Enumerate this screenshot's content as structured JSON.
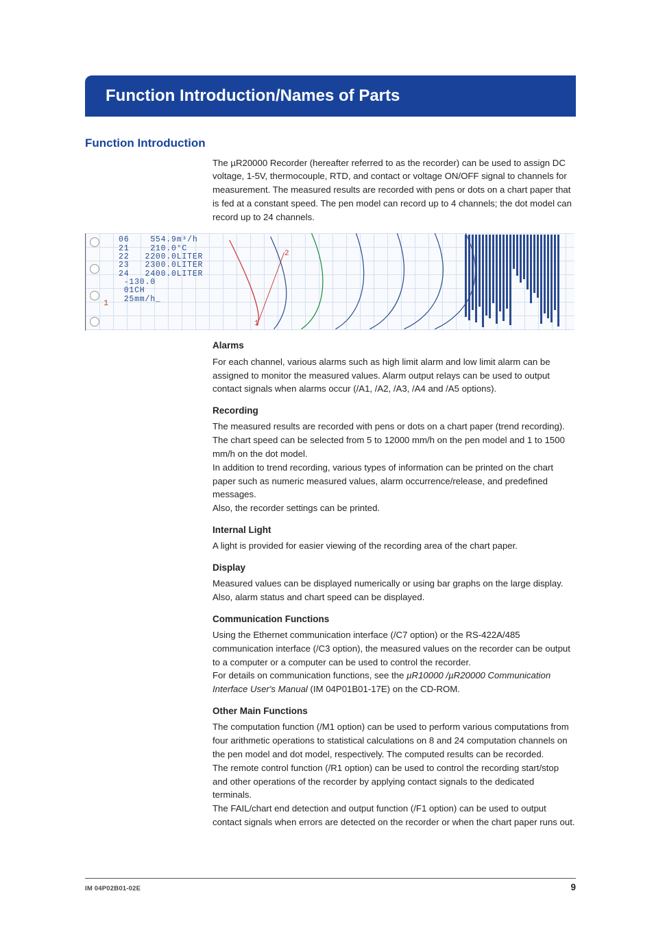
{
  "banner_title": "Function Introduction/Names of Parts",
  "section_title": "Function Introduction",
  "intro_paragraph": "The µR20000 Recorder (hereafter referred to as the recorder) can be used to assign DC voltage, 1-5V, thermocouple, RTD, and contact or voltage ON/OFF signal to channels for measurement. The measured results are recorded with pens or dots on a chart paper that is fed at a constant speed. The pen model can record up to 4 channels; the dot model can record up to 24 channels.",
  "figure": {
    "lcd_lines": "06    554.9m³/h\n21    210.0°C\n22   2200.0LITER\n23   2300.0LITER\n24   2400.0LITER\n -130.0\n 01CH\n 25mm/h_",
    "left_index": "1",
    "callouts": {
      "c1": "1",
      "c2": "2"
    }
  },
  "sections": [
    {
      "heading": "Alarms",
      "paragraphs": [
        "For each channel, various alarms such as high limit alarm and low limit alarm can be assigned to monitor the measured values. Alarm output relays can be used to output contact signals when alarms occur (/A1, /A2, /A3, /A4 and /A5 options)."
      ]
    },
    {
      "heading": "Recording",
      "paragraphs": [
        "The measured results are recorded with pens or dots on a chart paper (trend recording). The chart speed can be selected from 5 to 12000 mm/h on the pen model and 1 to 1500 mm/h on the dot model.",
        "In addition to trend recording, various types of information can be printed on the chart paper such as numeric measured values, alarm occurrence/release, and predefined messages.",
        "Also, the recorder settings can be printed."
      ]
    },
    {
      "heading": "Internal Light",
      "paragraphs": [
        "A light is provided for easier viewing of the recording area of the chart paper."
      ]
    },
    {
      "heading": "Display",
      "paragraphs": [
        "Measured values can be displayed numerically or using bar graphs on the large display. Also, alarm status and chart speed can be displayed."
      ]
    },
    {
      "heading": "Communication Functions",
      "paragraphs": [
        "Using the Ethernet communication interface (/C7 option) or the RS-422A/485 communication interface (/C3 option), the measured values on the recorder can be output to a computer or a computer can be used to control the recorder."
      ],
      "tail_plain_1": "For details on communication functions, see the ",
      "tail_italic": "µR10000 /µR20000 Communication Interface User's Manual",
      "tail_plain_2": " (IM 04P01B01-17E) on the CD-ROM."
    },
    {
      "heading": "Other Main Functions",
      "paragraphs": [
        "The computation function (/M1 option) can be used to perform various computations from four arithmetic operations to statistical calculations on 8 and 24 computation channels on the pen model and dot model, respectively. The computed results can be recorded.",
        "The remote control function (/R1 option) can be used to control the recording start/stop and other operations of the recorder by applying contact signals to the dedicated terminals.",
        "The FAIL/chart end detection and output function (/F1 option) can be used to output contact signals when errors are detected on the recorder or when the chart paper runs out."
      ]
    }
  ],
  "footer": {
    "doc_id": "IM 04P02B01-02E",
    "page": "9"
  }
}
